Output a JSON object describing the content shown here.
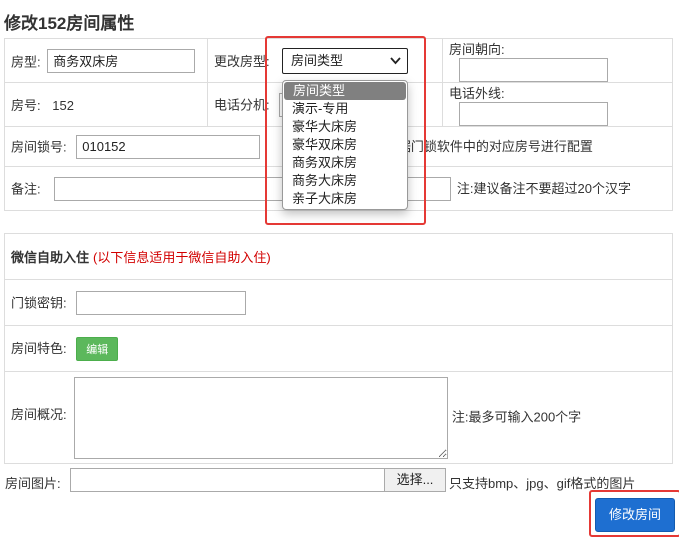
{
  "page": {
    "title": "修改152房间属性"
  },
  "form": {
    "room_type_label": "房型:",
    "room_type_value": "商务双床房",
    "change_type_label": "更改房型:",
    "select_value": "房间类型",
    "orientation_label": "房间朝向:",
    "room_no_label": "房号:",
    "room_no_value": "152",
    "phone_ext_label": "电话分机:",
    "phone_out_label": "电话外线:",
    "lock_label": "房间锁号:",
    "lock_value": "010152",
    "lock_note": "据门锁软件中的对应房号进行配置",
    "remark_label": "备注:",
    "remark_note": "注:建议备注不要超过20个汉字"
  },
  "dropdown": {
    "options": [
      "房间类型",
      "演示-专用",
      "豪华大床房",
      "豪华双床房",
      "商务双床房",
      "商务大床房",
      "亲子大床房"
    ]
  },
  "wechat": {
    "heading": "微信自助入住",
    "subheading": "(以下信息适用于微信自助入住)",
    "key_label": "门锁密钥:",
    "feature_label": "房间特色:",
    "edit_button": "编辑",
    "overview_label": "房间概况:",
    "overview_note": "注:最多可输入200个字"
  },
  "image": {
    "label": "房间图片:",
    "browse_button": "选择...",
    "note": "只支持bmp、jpg、gif格式的图片"
  },
  "submit_label": "修改房间",
  "colors": {
    "highlight": "#e53935",
    "primary": "#1e6fd1",
    "success": "#5cb85c"
  }
}
